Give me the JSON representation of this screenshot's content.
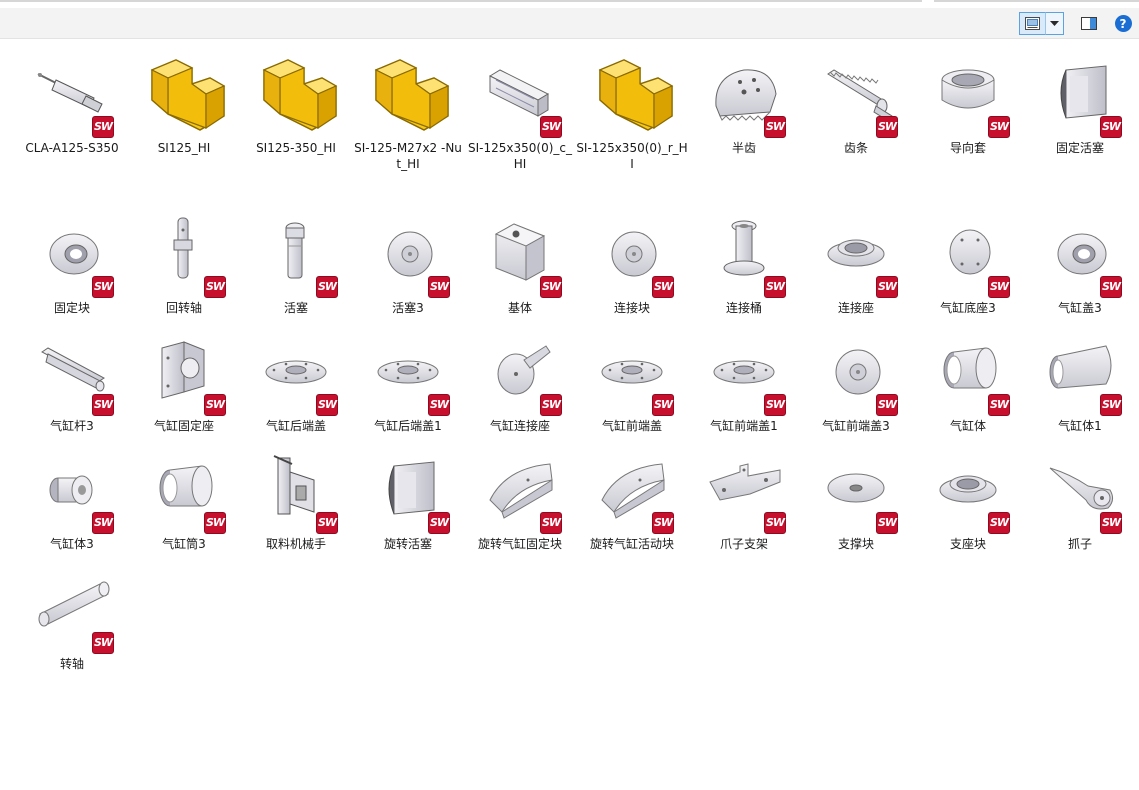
{
  "toolbar": {
    "buttons": [
      {
        "name": "change-view-button",
        "icon": "large-icons-view-icon"
      },
      {
        "name": "view-options-dropdown",
        "icon": "chevron-down-icon"
      },
      {
        "name": "preview-pane-button",
        "icon": "preview-pane-icon"
      },
      {
        "name": "help-button",
        "icon": "help-icon",
        "glyph": "?"
      }
    ]
  },
  "badge_text": "SW",
  "colors": {
    "folder_yellow": "#f6c81a",
    "folder_edge": "#caa114",
    "part_gray": "#d9d9df",
    "badge_red": "#c8102e",
    "accent_blue": "#1a6ed3"
  },
  "files": [
    {
      "name": "CLA-A125-S350",
      "type": "part",
      "icon": "cylinder-assembly-icon"
    },
    {
      "name": "SI125_HI",
      "type": "folder",
      "icon": "yellow-part-icon"
    },
    {
      "name": "SI125-350_HI",
      "type": "folder",
      "icon": "yellow-part-icon"
    },
    {
      "name": "SI-125-M27x2 -Nut_HI",
      "type": "folder",
      "icon": "yellow-part-icon"
    },
    {
      "name": "SI-125x350(0)_c_HI",
      "type": "part",
      "icon": "cylinder-body-icon"
    },
    {
      "name": "SI-125x350(0)_r_HI",
      "type": "folder",
      "icon": "yellow-part-icon"
    },
    {
      "name": "半齿",
      "type": "part",
      "icon": "half-gear-icon"
    },
    {
      "name": "齿条",
      "type": "part",
      "icon": "rack-icon"
    },
    {
      "name": "导向套",
      "type": "part",
      "icon": "guide-sleeve-icon"
    },
    {
      "name": "固定活塞",
      "type": "part",
      "icon": "fixed-piston-icon"
    },
    {
      "name": "固定块",
      "type": "part",
      "icon": "ring-block-icon"
    },
    {
      "name": "回转轴",
      "type": "part",
      "icon": "rotary-shaft-icon"
    },
    {
      "name": "活塞",
      "type": "part",
      "icon": "piston-icon"
    },
    {
      "name": "活塞3",
      "type": "part",
      "icon": "disc-icon"
    },
    {
      "name": "基体",
      "type": "part",
      "icon": "base-block-icon"
    },
    {
      "name": "连接块",
      "type": "part",
      "icon": "disc-icon"
    },
    {
      "name": "连接桶",
      "type": "part",
      "icon": "spool-icon"
    },
    {
      "name": "连接座",
      "type": "part",
      "icon": "flange-ring-icon"
    },
    {
      "name": "气缸底座3",
      "type": "part",
      "icon": "disc-holes-icon"
    },
    {
      "name": "气缸盖3",
      "type": "part",
      "icon": "ring-block-icon"
    },
    {
      "name": "气缸杆3",
      "type": "part",
      "icon": "rod-icon"
    },
    {
      "name": "气缸固定座",
      "type": "part",
      "icon": "bracket-icon"
    },
    {
      "name": "气缸后端盖",
      "type": "part",
      "icon": "flat-flange-icon"
    },
    {
      "name": "气缸后端盖1",
      "type": "part",
      "icon": "flat-flange-icon"
    },
    {
      "name": "气缸连接座",
      "type": "part",
      "icon": "lever-disc-icon"
    },
    {
      "name": "气缸前端盖",
      "type": "part",
      "icon": "flat-flange-icon"
    },
    {
      "name": "气缸前端盖1",
      "type": "part",
      "icon": "flat-flange-icon"
    },
    {
      "name": "气缸前端盖3",
      "type": "part",
      "icon": "disc-icon"
    },
    {
      "name": "气缸体",
      "type": "part",
      "icon": "tube-icon"
    },
    {
      "name": "气缸体1",
      "type": "part",
      "icon": "tube-long-icon"
    },
    {
      "name": "气缸体3",
      "type": "part",
      "icon": "small-tube-icon"
    },
    {
      "name": "气缸筒3",
      "type": "part",
      "icon": "tube-icon"
    },
    {
      "name": "取料机械手",
      "type": "part",
      "icon": "gripper-assembly-icon"
    },
    {
      "name": "旋转活塞",
      "type": "part",
      "icon": "fixed-piston-icon"
    },
    {
      "name": "旋转气缸固定块",
      "type": "part",
      "icon": "arc-block-icon"
    },
    {
      "name": "旋转气缸活动块",
      "type": "part",
      "icon": "arc-block-icon"
    },
    {
      "name": "爪子支架",
      "type": "part",
      "icon": "claw-bracket-icon"
    },
    {
      "name": "支撑块",
      "type": "part",
      "icon": "washer-icon"
    },
    {
      "name": "支座块",
      "type": "part",
      "icon": "flange-ring-icon"
    },
    {
      "name": "抓子",
      "type": "part",
      "icon": "claw-icon"
    },
    {
      "name": "转轴",
      "type": "part",
      "icon": "shaft-icon"
    }
  ]
}
